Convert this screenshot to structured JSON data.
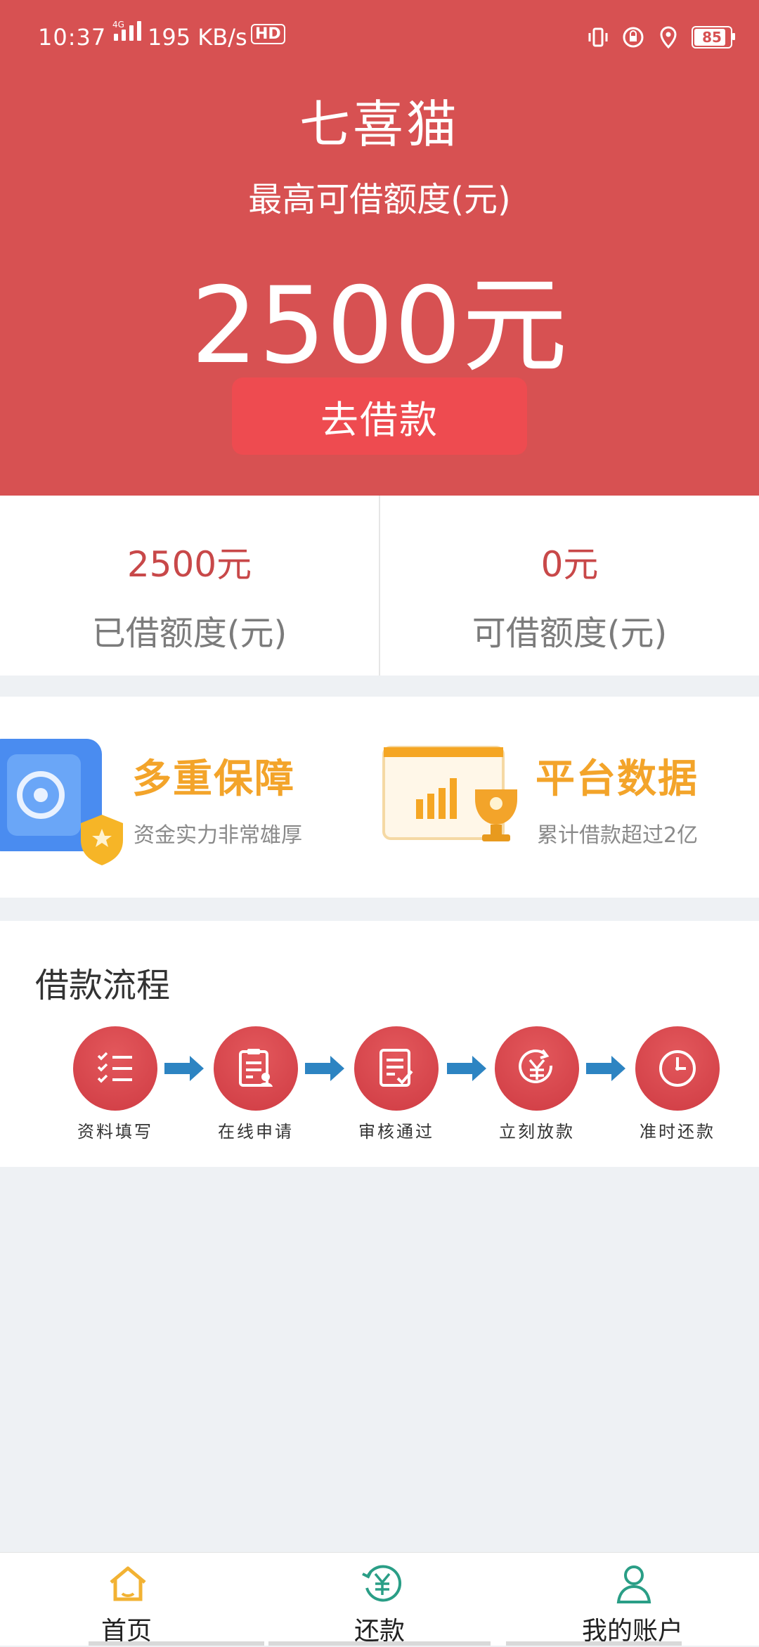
{
  "status_bar": {
    "time": "10:37",
    "network": "4G",
    "speed": "195 KB/s",
    "hd": "HD",
    "battery": "85"
  },
  "header": {
    "app_title": "七喜猫",
    "limit_label": "最高可借额度(元)",
    "amount": "2500元",
    "borrow_button": "去借款"
  },
  "stats": [
    {
      "value": "2500元",
      "label": "已借额度(元)"
    },
    {
      "value": "0元",
      "label": "可借额度(元)"
    }
  ],
  "features": [
    {
      "title": "多重保障",
      "subtitle": "资金实力非常雄厚"
    },
    {
      "title": "平台数据",
      "subtitle": "累计借款超过2亿"
    }
  ],
  "process": {
    "title": "借款流程",
    "steps": [
      "资料填写",
      "在线申请",
      "审核通过",
      "立刻放款",
      "准时还款"
    ]
  },
  "tabbar": {
    "items": [
      {
        "label": "首页",
        "icon": "home-icon",
        "color": "#f2b233"
      },
      {
        "label": "还款",
        "icon": "repay-yen-icon",
        "color": "#2a9e86"
      },
      {
        "label": "我的账户",
        "icon": "user-icon",
        "color": "#2a9e86"
      }
    ]
  },
  "colors": {
    "header_bg": "#d75152",
    "button_bg": "#ee4b50",
    "stat_value": "#c84849",
    "feature_title": "#f3a42a",
    "step_circle": "#d4434a",
    "arrow": "#2d84c2"
  }
}
